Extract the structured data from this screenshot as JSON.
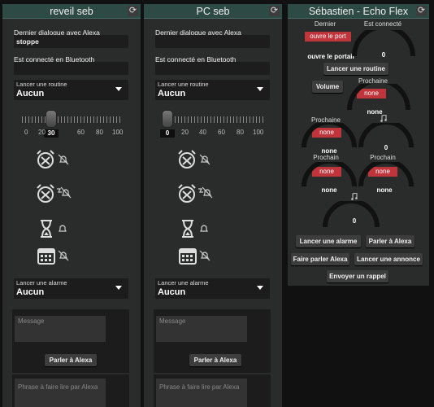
{
  "panel1": {
    "title": "reveil seb",
    "last_dialog_label": "Dernier dialogue avec Alexa",
    "last_dialog_value": "stoppe",
    "bt_label": "Est connecté en Bluetooth",
    "bt_value": "",
    "routine_label": "Lancer une routine",
    "routine_value": "Aucun",
    "volume": {
      "value": 30,
      "ticks": [
        "0",
        "20",
        "40",
        "60",
        "80",
        "100"
      ]
    },
    "alarm_label": "Lancer une alarme",
    "alarm_value": "Aucun",
    "message_placeholder": "Message",
    "speak_button": "Parler à Alexa",
    "phrase_placeholder": "Phrase à faire lire par Alexa"
  },
  "panel2": {
    "title": "PC seb",
    "last_dialog_label": "Dernier dialogue avec Alexa",
    "last_dialog_value": "",
    "bt_label": "Est connecté en Bluetooth",
    "bt_value": "",
    "routine_label": "Lancer une routine",
    "routine_value": "Aucun",
    "volume": {
      "value": 0,
      "ticks": [
        "20",
        "40",
        "60",
        "80",
        "100"
      ]
    },
    "alarm_label": "Lancer une alarme",
    "alarm_value": "Aucun",
    "message_placeholder": "Message",
    "speak_button": "Parler à Alexa",
    "phrase_placeholder": "Phrase à faire lire par Alexa"
  },
  "panel3": {
    "title": "Sébastien - Echo Flex",
    "dernier_label": "Dernier",
    "dernier_button": "ouvre le port",
    "dernier_value": "ouvre le portail",
    "connected_label": "Est connecté",
    "connected_value": "0",
    "routine_button": "Lancer une routine",
    "volume_button": "Volume",
    "prochaine1_label": "Prochaine",
    "prochaine1_button": "none",
    "prochaine1_value": "none",
    "prochaine2_label": "Prochaine",
    "prochaine2_button": "none",
    "prochaine2_value": "none",
    "gauge2_value": "0",
    "prochain1_label": "Prochain",
    "prochain1_button": "none",
    "prochain1_value": "none",
    "prochain2_label": "Prochain",
    "prochain2_button": "none",
    "prochain2_value": "none",
    "gauge3_value": "0",
    "btn_alarm": "Lancer une alarme",
    "btn_speak": "Parler à Alexa",
    "btn_make_speak": "Faire parler Alexa",
    "btn_announce": "Lancer une annonce",
    "btn_reminder": "Envoyer un rappel"
  },
  "colors": {
    "header": "#2e4a45",
    "accent_red": "#c0343b",
    "panel": "#2a2b2b"
  },
  "icons": [
    "refresh-icon",
    "alarm-clock-icon",
    "bell-off-icon",
    "alarm-snooze-icon",
    "timer-icon",
    "bell-icon",
    "calendar-icon",
    "music-note-icon",
    "dropdown-arrow-icon"
  ]
}
